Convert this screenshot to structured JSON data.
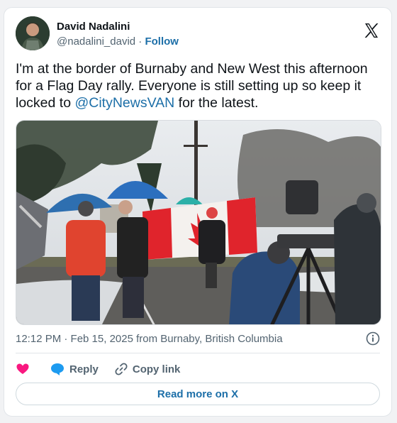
{
  "author": {
    "name": "David Nadalini",
    "handle": "@nadalini_david",
    "separator": " · ",
    "follow_label": "Follow"
  },
  "tweet": {
    "text_before": "I'm at the border of Burnaby and New West this afternoon for a Flag Day rally. Everyone is still setting up so keep it locked to ",
    "mention": "@CityNewsVAN",
    "text_after": " for the latest."
  },
  "meta": {
    "timestamp": "12:12 PM · Feb 15, 2025 from Burnaby, British Columbia"
  },
  "actions": {
    "reply_label": "Reply",
    "copy_link_label": "Copy link"
  },
  "read_more_label": "Read more on X",
  "colors": {
    "link": "#1d6fa8",
    "heart": "#f91880",
    "reply_bubble": "#1d9bf0",
    "flag_red": "#e0242c"
  },
  "icons": [
    "x-logo-icon",
    "info-icon",
    "heart-icon",
    "reply-icon",
    "link-icon"
  ]
}
